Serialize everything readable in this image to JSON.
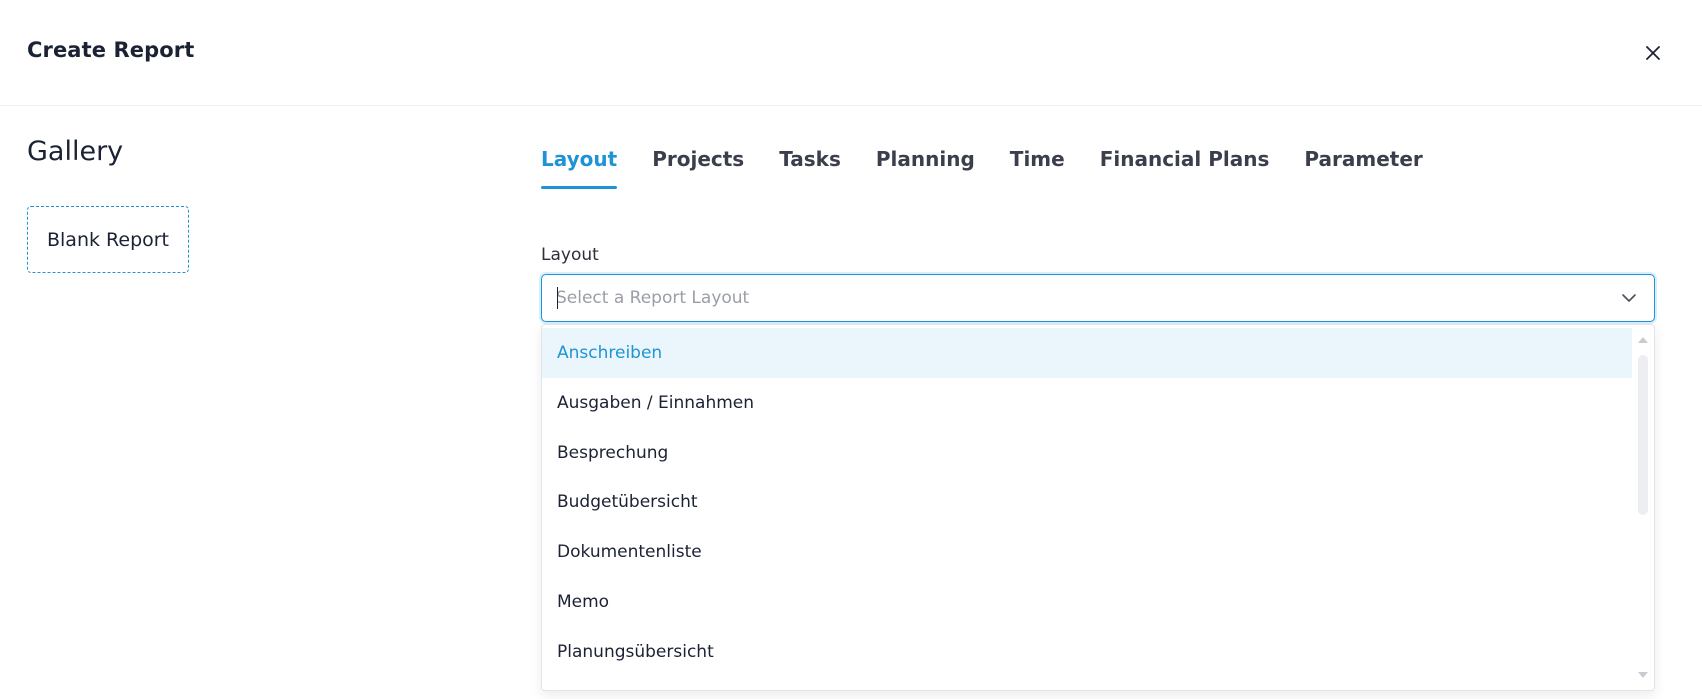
{
  "header": {
    "title": "Create Report",
    "close_icon": "close-icon"
  },
  "gallery": {
    "title": "Gallery",
    "blank_report_label": "Blank Report"
  },
  "tabs": [
    {
      "label": "Layout",
      "active": true
    },
    {
      "label": "Projects",
      "active": false
    },
    {
      "label": "Tasks",
      "active": false
    },
    {
      "label": "Planning",
      "active": false
    },
    {
      "label": "Time",
      "active": false
    },
    {
      "label": "Financial Plans",
      "active": false
    },
    {
      "label": "Parameter",
      "active": false
    }
  ],
  "layout_field": {
    "label": "Layout",
    "value": "",
    "placeholder": "Select a Report Layout",
    "chevron_icon": "chevron-down-icon"
  },
  "dropdown": {
    "options": [
      {
        "label": "Anschreiben",
        "highlighted": true
      },
      {
        "label": "Ausgaben / Einnahmen",
        "highlighted": false
      },
      {
        "label": "Besprechung",
        "highlighted": false
      },
      {
        "label": "Budgetübersicht",
        "highlighted": false
      },
      {
        "label": "Dokumentenliste",
        "highlighted": false
      },
      {
        "label": "Memo",
        "highlighted": false
      },
      {
        "label": "Planungsübersicht",
        "highlighted": false
      }
    ]
  },
  "colors": {
    "accent": "#1e94d6",
    "highlight_bg": "#eaf5fc",
    "text": "#1b2233"
  }
}
